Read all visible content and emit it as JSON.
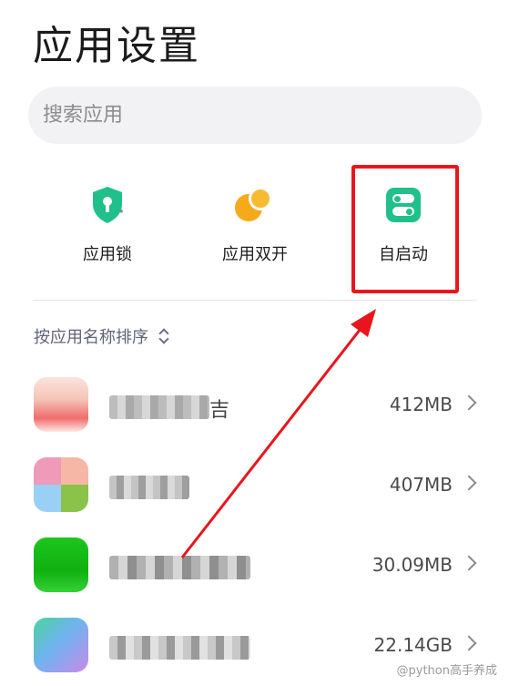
{
  "header": {
    "title": "应用设置"
  },
  "search": {
    "placeholder": "搜索应用"
  },
  "features": [
    {
      "label": "应用锁",
      "icon": "shield-lock-icon",
      "color": "#21c08b"
    },
    {
      "label": "应用双开",
      "icon": "dual-circle-icon",
      "color": "#f6a91b"
    },
    {
      "label": "自启动",
      "icon": "toggle-switch-icon",
      "color": "#21c08b",
      "highlighted": true
    }
  ],
  "sort": {
    "label": "按应用名称排序"
  },
  "apps": [
    {
      "name_visible": "吉",
      "size": "412MB"
    },
    {
      "name_visible": "",
      "size": "407MB"
    },
    {
      "name_visible": "",
      "size": "30.09MB"
    },
    {
      "name_visible": "",
      "size": "22.14GB"
    }
  ],
  "annotation": {
    "box_color": "#e8161c",
    "arrow_color": "#e8161c"
  },
  "watermark": {
    "text": "@python高手养成"
  }
}
